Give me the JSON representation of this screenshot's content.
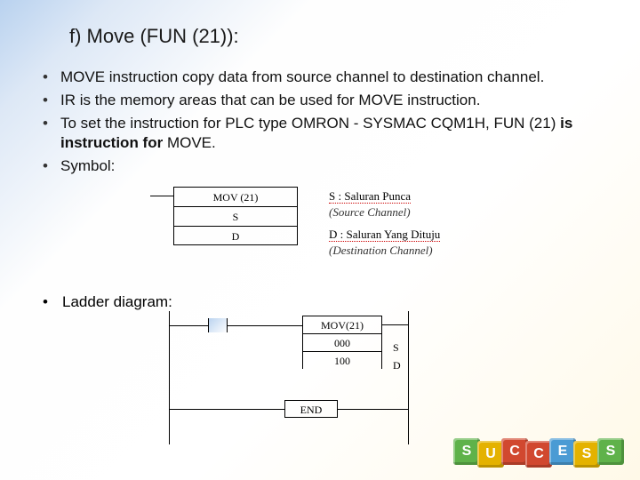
{
  "title": "f) Move (FUN (21)):",
  "bullets": {
    "b1": "MOVE instruction copy data from source channel to destination channel.",
    "b2": "IR is the memory areas that can be used for MOVE instruction.",
    "b3_pre": "To set the instruction for PLC type OMRON - SYSMAC CQM1H, FUN (21) ",
    "b3_bold": "is instruction for",
    "b3_post": " MOVE.",
    "b4": "Symbol:",
    "b5": "Ladder diagram:"
  },
  "symbol_block": {
    "r1": "MOV (21)",
    "r2": "S",
    "r3": "D"
  },
  "legend": {
    "s_head": "S  :  Saluran Punca",
    "s_sub": "(Source Channel)",
    "d_head": "D :  Saluran Yang Dituju",
    "d_sub": "(Destination Channel)"
  },
  "ladder": {
    "i1": "MOV(21)",
    "i2": "000",
    "i3": "100",
    "sideS": "S",
    "sideD": "D",
    "end": "END"
  },
  "blocks": [
    "S",
    "U",
    "C",
    "C",
    "E",
    "S",
    "S"
  ]
}
